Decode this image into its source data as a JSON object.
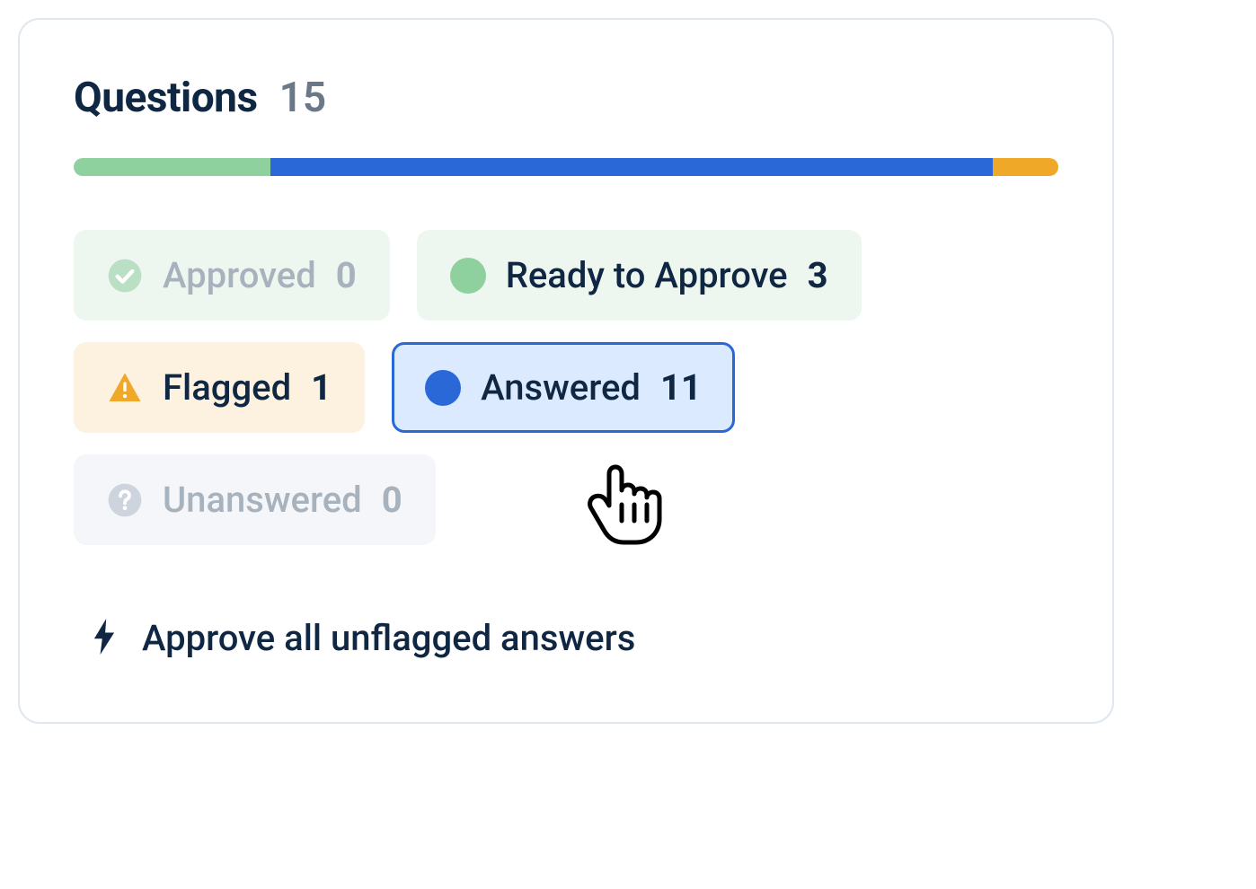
{
  "header": {
    "title": "Questions",
    "count": "15"
  },
  "progress": {
    "segments": [
      {
        "color": "#8fd19e",
        "percent": 20
      },
      {
        "color": "#2a68d8",
        "percent": 73.3
      },
      {
        "color": "#f0a829",
        "percent": 6.7
      }
    ]
  },
  "chips": {
    "approved": {
      "label": "Approved",
      "count": "0",
      "icon_color": "#b9dfc4"
    },
    "ready": {
      "label": "Ready to Approve",
      "count": "3",
      "dot_color": "#8fd19e"
    },
    "flagged": {
      "label": "Flagged",
      "count": "1",
      "icon_color": "#f0a829"
    },
    "answered": {
      "label": "Answered",
      "count": "11",
      "dot_color": "#2a68d8"
    },
    "unanswered": {
      "label": "Unanswered",
      "count": "0",
      "icon_color": "#cdd4dd"
    }
  },
  "action": {
    "label": "Approve all unflagged answers"
  }
}
